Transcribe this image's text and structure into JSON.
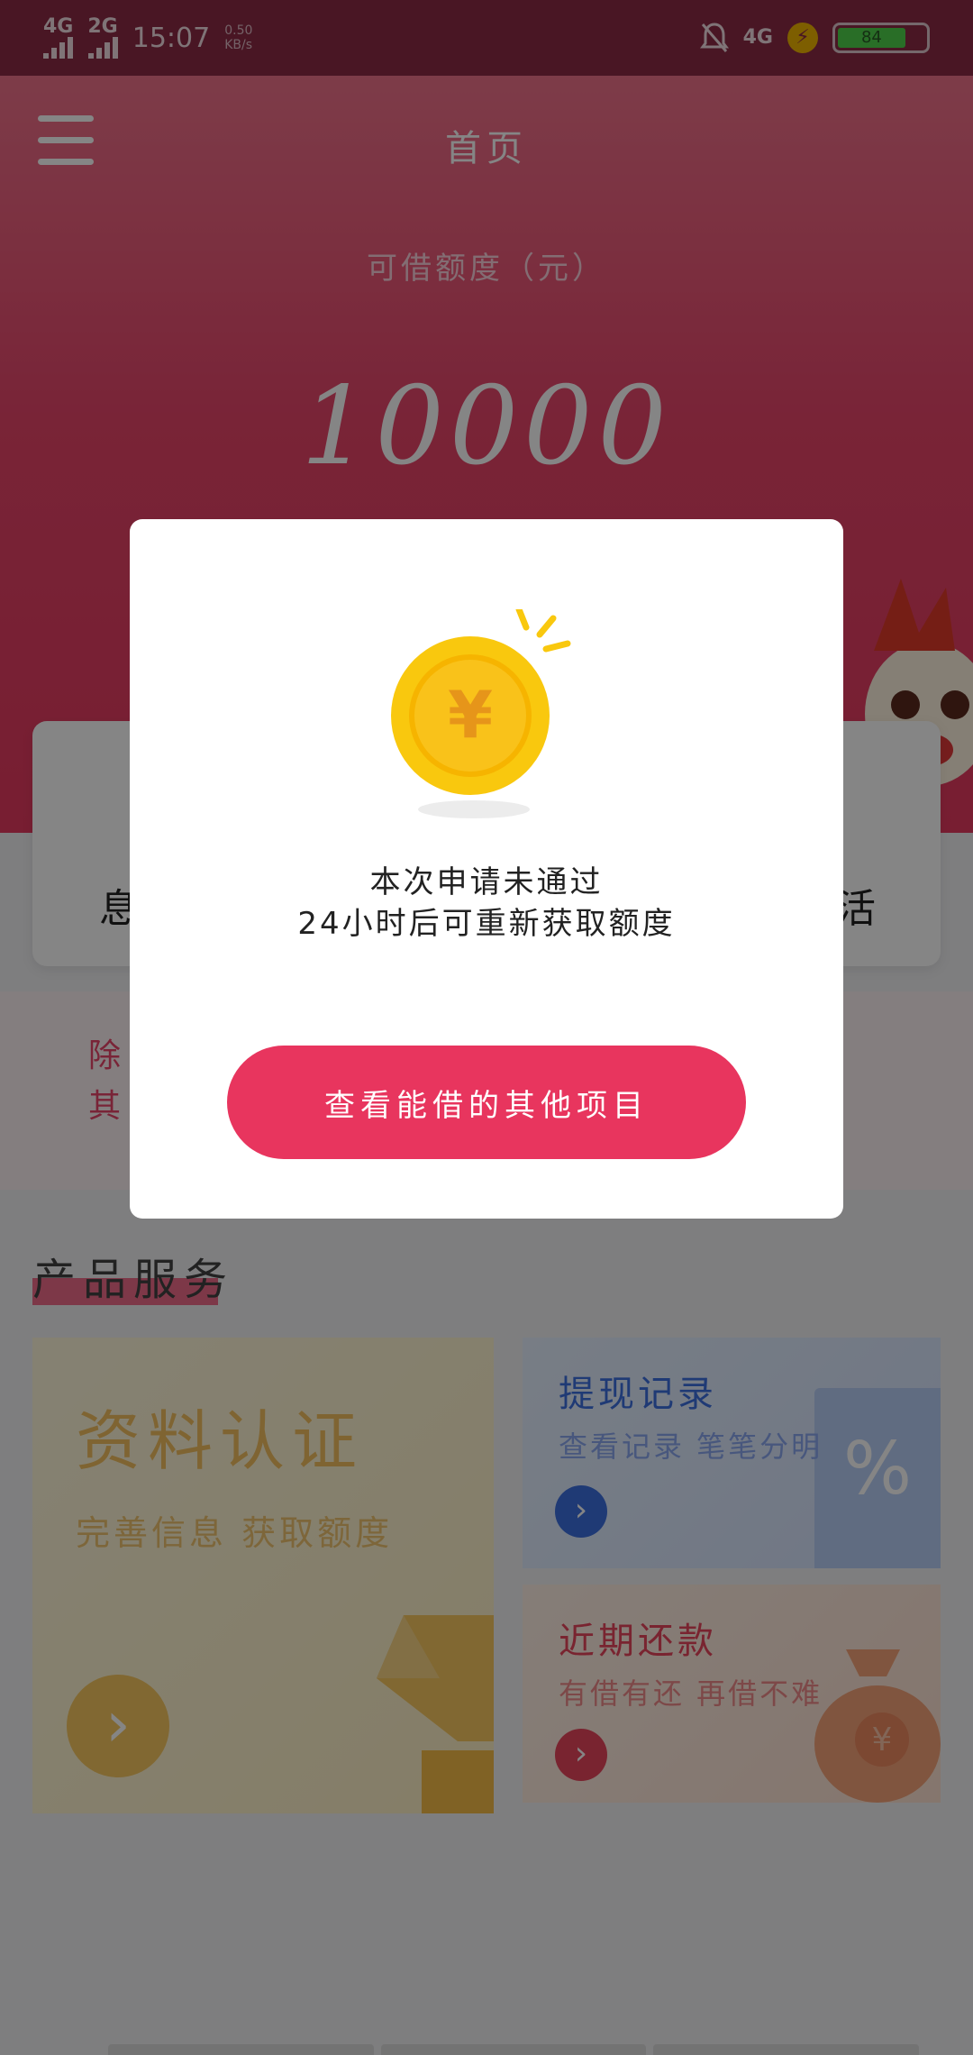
{
  "status_bar": {
    "net1": "4G",
    "net2": "2G",
    "time": "15:07",
    "speed_value": "0.50",
    "speed_unit": "KB/s",
    "net3": "4G",
    "battery": "84"
  },
  "header": {
    "title": "首页"
  },
  "hero": {
    "quota_label": "可借额度（元）",
    "quota_value": "10000"
  },
  "card": {
    "left_fragment": "息",
    "right_fragment": "活"
  },
  "notice": {
    "line1": "除",
    "line2": "其"
  },
  "products": {
    "section_title": "产品服务",
    "verify": {
      "title": "资料认证",
      "subtitle": "完善信息 获取额度"
    },
    "withdraw_records": {
      "title": "提现记录",
      "subtitle": "查看记录 笔笔分明"
    },
    "recent_repay": {
      "title": "近期还款",
      "subtitle": "有借有还 再借不难"
    }
  },
  "dialog": {
    "message_line1": "本次申请未通过",
    "message_line2": "24小时后可重新获取额度",
    "button_label": "查看能借的其他项目"
  },
  "colors": {
    "brand": "#e8355e",
    "blue_accent": "#3d6fe0",
    "gold": "#f7c760"
  },
  "icons": {
    "menu": "menu-icon",
    "coin": "yen-coin-icon",
    "arrow": "chevron-right-icon"
  }
}
